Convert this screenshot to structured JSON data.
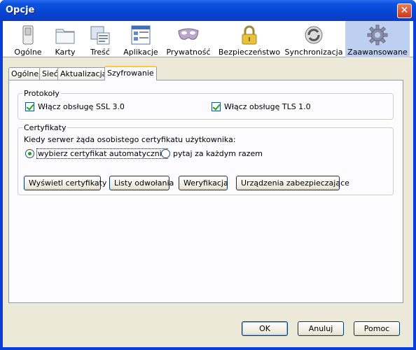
{
  "window": {
    "title": "Opcje",
    "close_glyph": "✕"
  },
  "toolbar": {
    "panes": [
      {
        "label": "Ogólne",
        "icon": "switch-icon"
      },
      {
        "label": "Karty",
        "icon": "folder-tabs-icon"
      },
      {
        "label": "Treść",
        "icon": "content-icon"
      },
      {
        "label": "Aplikacje",
        "icon": "applications-icon"
      },
      {
        "label": "Prywatność",
        "icon": "mask-icon"
      },
      {
        "label": "Bezpieczeństwo",
        "icon": "padlock-icon"
      },
      {
        "label": "Synchronizacja",
        "icon": "sync-icon"
      },
      {
        "label": "Zaawansowane",
        "icon": "gear-icon",
        "selected": true
      }
    ]
  },
  "tabs": [
    {
      "label": "Ogólne"
    },
    {
      "label": "Sieć"
    },
    {
      "label": "Aktualizacja"
    },
    {
      "label": "Szyfrowanie",
      "active": true
    }
  ],
  "protocols": {
    "legend": "Protokoły",
    "ssl_label": "Włącz obsługę SSL 3.0",
    "ssl_checked": true,
    "tls_label": "Włącz obsługę TLS 1.0",
    "tls_checked": true
  },
  "certificates": {
    "legend": "Certyfikaty",
    "prompt": "Kiedy serwer żąda osobistego certyfikatu użytkownika:",
    "radio_auto": "wybierz certyfikat automatycznie",
    "radio_ask": "pytaj za każdym razem",
    "selected": "auto",
    "buttons": {
      "view": "Wyświetl certyfikaty",
      "revocation": "Listy odwołania",
      "verification": "Weryfikacja",
      "devices": "Urządzenia zabezpieczające"
    }
  },
  "footer": {
    "ok": "OK",
    "cancel": "Anuluj",
    "help": "Pomoc"
  },
  "colors": {
    "titlebar": "#0a45d2",
    "selected_pane": "#bdd0f2",
    "check": "#21a121"
  }
}
